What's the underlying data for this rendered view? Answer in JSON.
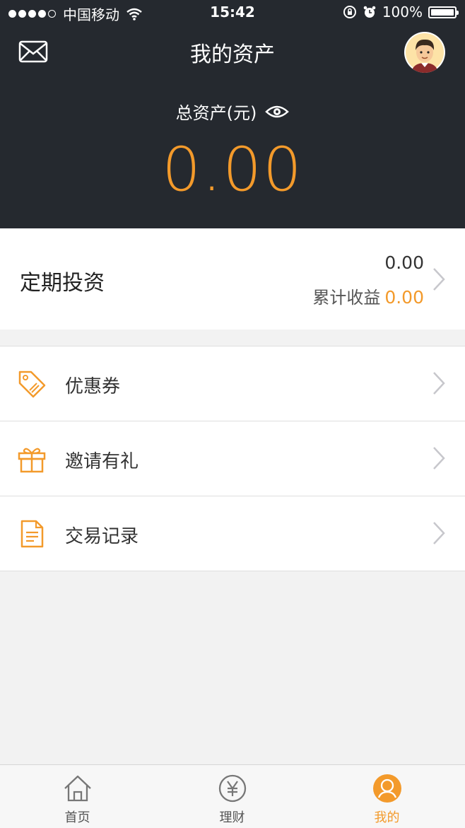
{
  "status_bar": {
    "carrier": "中国移动",
    "time": "15:42",
    "battery": "100%"
  },
  "header": {
    "title": "我的资产",
    "total_label": "总资产(元)",
    "total_value": "0.00",
    "icons": [
      "mail-icon",
      "avatar",
      "eye-icon"
    ]
  },
  "invest": {
    "title": "定期投资",
    "amount": "0.00",
    "income_label": "累计收益",
    "income_value": "0.00"
  },
  "menu": {
    "items": [
      {
        "label": "优惠券",
        "icon": "coupon-tag-icon"
      },
      {
        "label": "邀请有礼",
        "icon": "gift-icon"
      },
      {
        "label": "交易记录",
        "icon": "document-icon"
      }
    ]
  },
  "tabbar": {
    "tabs": [
      {
        "label": "首页",
        "icon": "home-icon",
        "active": false
      },
      {
        "label": "理财",
        "icon": "yen-icon",
        "active": false
      },
      {
        "label": "我的",
        "icon": "profile-icon",
        "active": true
      }
    ]
  },
  "colors": {
    "header_bg": "#25292f",
    "accent": "#f39a2b",
    "page_bg": "#f2f2f2"
  }
}
